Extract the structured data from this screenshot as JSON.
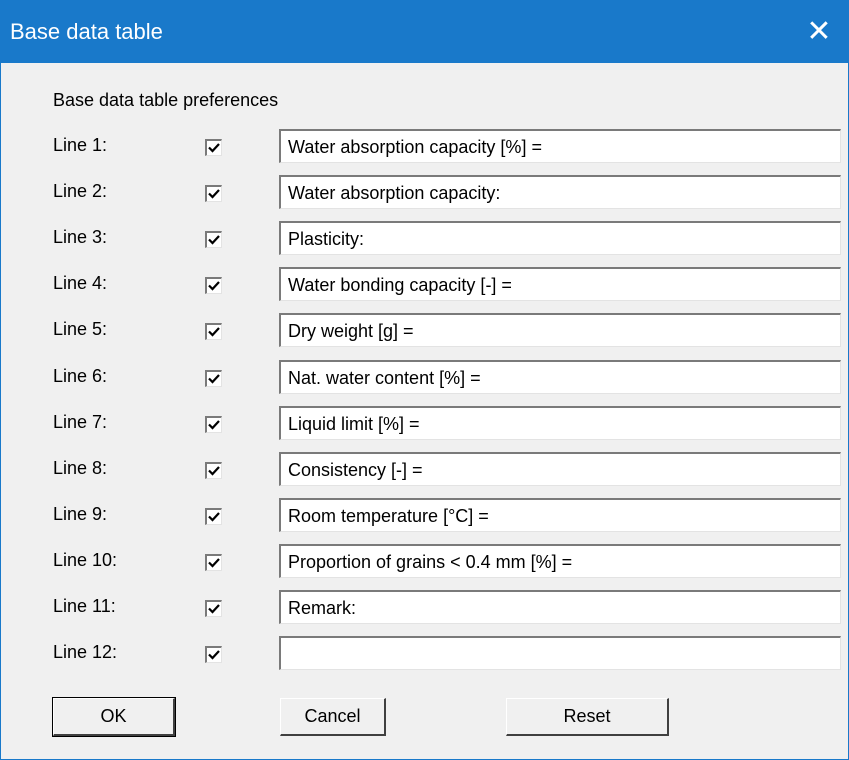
{
  "window": {
    "title": "Base data table",
    "close_icon": "close-icon"
  },
  "group_label": "Base data table preferences",
  "lines": [
    {
      "label": "Line 1:",
      "checked": true,
      "value": "Water absorption capacity [%] ="
    },
    {
      "label": "Line 2:",
      "checked": true,
      "value": "Water absorption capacity:"
    },
    {
      "label": "Line 3:",
      "checked": true,
      "value": "Plasticity:"
    },
    {
      "label": "Line 4:",
      "checked": true,
      "value": "Water bonding capacity [-] ="
    },
    {
      "label": "Line 5:",
      "checked": true,
      "value": "Dry weight [g] ="
    },
    {
      "label": "Line 6:",
      "checked": true,
      "value": "Nat. water content [%] ="
    },
    {
      "label": "Line 7:",
      "checked": true,
      "value": "Liquid limit [%] ="
    },
    {
      "label": "Line 8:",
      "checked": true,
      "value": "Consistency [-] ="
    },
    {
      "label": "Line 9:",
      "checked": true,
      "value": "Room temperature [°C] ="
    },
    {
      "label": "Line 10:",
      "checked": true,
      "value": "Proportion of grains < 0.4 mm [%] ="
    },
    {
      "label": "Line 11:",
      "checked": true,
      "value": "Remark:"
    },
    {
      "label": "Line 12:",
      "checked": true,
      "value": ""
    }
  ],
  "buttons": {
    "ok_label": "OK",
    "cancel_label": "Cancel",
    "reset_label": "Reset"
  },
  "colors": {
    "titlebar": "#1979ca",
    "dialog_bg": "#f0f0f0"
  }
}
